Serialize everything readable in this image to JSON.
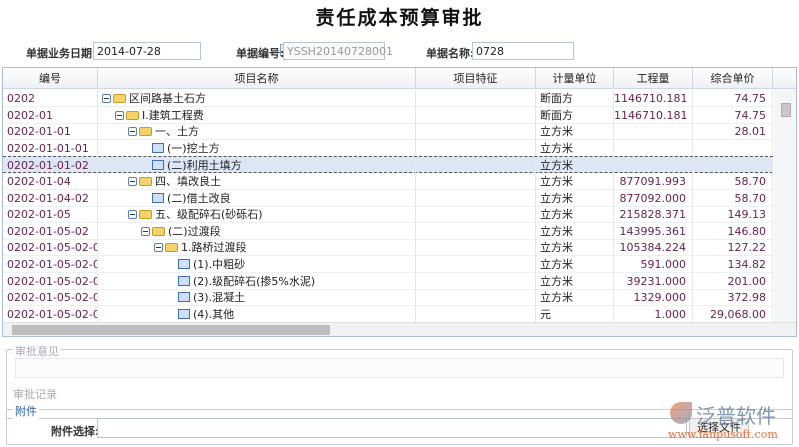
{
  "title": "责任成本预算审批",
  "form": {
    "date_label": "单据业务日期:",
    "date_value": "2014-07-28",
    "no_label": "单据编号:",
    "no_value": "YSSH20140728001",
    "name_label": "单据名称:",
    "name_value": "0728"
  },
  "table": {
    "headers": [
      "编号",
      "项目名称",
      "项目特征",
      "计量单位",
      "工程量",
      "综合单价"
    ],
    "rows": [
      {
        "code": "0202",
        "name": "区间路基土石方",
        "level": 0,
        "type": "folder",
        "unit": "断面方",
        "qty": "1146710.181",
        "price": "74.75"
      },
      {
        "code": "0202-01",
        "name": "Ⅰ.建筑工程费",
        "level": 1,
        "type": "folder",
        "unit": "断面方",
        "qty": "1146710.181",
        "price": "74.75"
      },
      {
        "code": "0202-01-01",
        "name": "一、土方",
        "level": 2,
        "type": "folder",
        "unit": "立方米",
        "qty": "",
        "price": "28.01"
      },
      {
        "code": "0202-01-01-01",
        "name": "(一)挖土方",
        "level": 3,
        "type": "leaf",
        "unit": "立方米",
        "qty": "",
        "price": ""
      },
      {
        "code": "0202-01-01-02",
        "name": "(二)利用土填方",
        "level": 3,
        "type": "leaf",
        "unit": "立方米",
        "qty": "",
        "price": "",
        "selected": true
      },
      {
        "code": "0202-01-04",
        "name": "四、填改良土",
        "level": 2,
        "type": "folder",
        "unit": "立方米",
        "qty": "877091.993",
        "price": "58.70"
      },
      {
        "code": "0202-01-04-02",
        "name": "(二)借土改良",
        "level": 3,
        "type": "leaf",
        "unit": "立方米",
        "qty": "877092.000",
        "price": "58.70"
      },
      {
        "code": "0202-01-05",
        "name": "五、级配碎石(砂砾石)",
        "level": 2,
        "type": "folder",
        "unit": "立方米",
        "qty": "215828.371",
        "price": "149.13"
      },
      {
        "code": "0202-01-05-02",
        "name": "(二)过渡段",
        "level": 3,
        "type": "folder",
        "unit": "立方米",
        "qty": "143995.361",
        "price": "146.80"
      },
      {
        "code": "0202-01-05-02-01",
        "name": "1.路桥过渡段",
        "level": 4,
        "type": "folder",
        "unit": "立方米",
        "qty": "105384.224",
        "price": "127.22"
      },
      {
        "code": "0202-01-05-02-0...",
        "name": "(1).中粗砂",
        "level": 5,
        "type": "leaf",
        "unit": "立方米",
        "qty": "591.000",
        "price": "134.82"
      },
      {
        "code": "0202-01-05-02-0...",
        "name": "(2).级配碎石(掺5%水泥)",
        "level": 5,
        "type": "leaf",
        "unit": "立方米",
        "qty": "39231.000",
        "price": "201.00"
      },
      {
        "code": "0202-01-05-02-0...",
        "name": "(3).混凝土",
        "level": 5,
        "type": "leaf",
        "unit": "立方米",
        "qty": "1329.000",
        "price": "372.98"
      },
      {
        "code": "0202-01-05-02-0...",
        "name": "(4).其他",
        "level": 5,
        "type": "leaf",
        "unit": "元",
        "qty": "1.000",
        "price": "29,068.00"
      }
    ]
  },
  "approval": {
    "legend": "审批意见",
    "records_label": "审批记录"
  },
  "attachment": {
    "legend": "附件",
    "select_label": "附件选择:",
    "button": "选择文件"
  },
  "watermark": {
    "brand": "泛普软件",
    "url": "www.fanpusoft.com"
  },
  "colors": {
    "accent": "#2a5aa8",
    "border": "#a9bed8",
    "selected": "#dde6f4"
  }
}
